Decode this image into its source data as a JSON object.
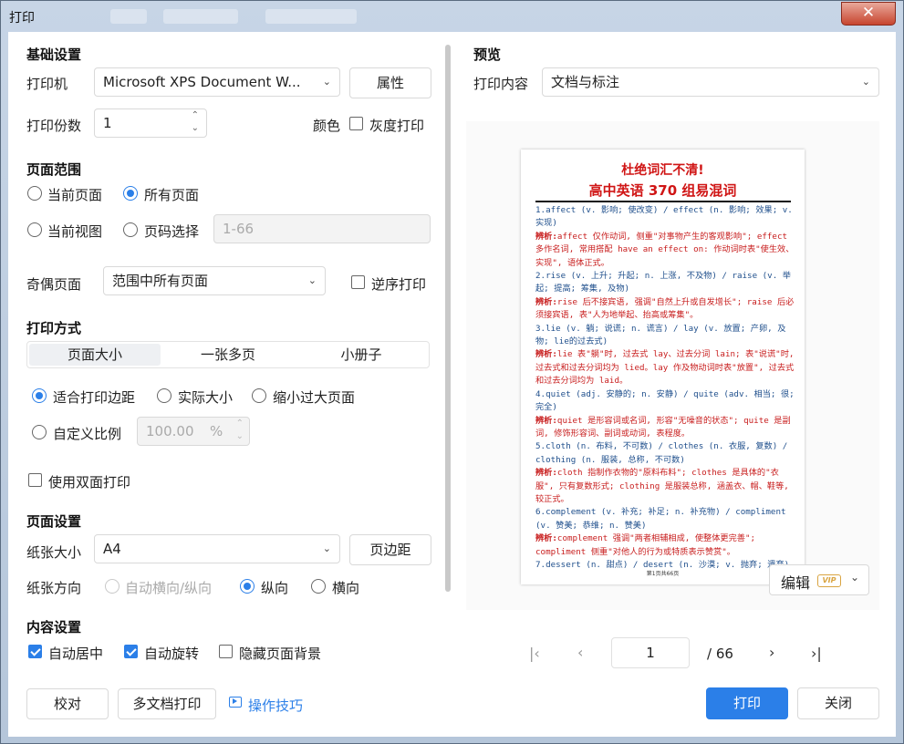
{
  "window": {
    "title": "打印",
    "close_glyph": "✕"
  },
  "basic": {
    "heading": "基础设置",
    "printer_label": "打印机",
    "printer_value": "Microsoft XPS Document W...",
    "properties_button": "属性",
    "copies_label": "打印份数",
    "copies_value": "1",
    "color_label": "颜色",
    "grayscale_label": "灰度打印",
    "grayscale_checked": false
  },
  "range": {
    "heading": "页面范围",
    "current_page": "当前页面",
    "all_pages": "所有页面",
    "current_view": "当前视图",
    "page_select": "页码选择",
    "page_select_placeholder": "1-66",
    "selected": "all_pages",
    "odd_even_label": "奇偶页面",
    "odd_even_value": "范围中所有页面",
    "reverse_label": "逆序打印",
    "reverse_checked": false
  },
  "method": {
    "heading": "打印方式",
    "tabs": [
      "页面大小",
      "一张多页",
      "小册子"
    ],
    "active_tab": 0,
    "fit_margins": "适合打印边距",
    "actual_size": "实际大小",
    "shrink_large": "缩小过大页面",
    "custom_scale": "自定义比例",
    "scale_value": "100.00",
    "scale_unit": "%",
    "selected": "fit_margins",
    "duplex_label": "使用双面打印",
    "duplex_checked": false
  },
  "page_setup": {
    "heading": "页面设置",
    "paper_size_label": "纸张大小",
    "paper_size_value": "A4",
    "margins_button": "页边距",
    "orientation_label": "纸张方向",
    "auto_orientation": "自动横向/纵向",
    "portrait": "纵向",
    "landscape": "横向",
    "selected": "portrait"
  },
  "content_setup": {
    "heading": "内容设置",
    "auto_center": "自动居中",
    "auto_center_checked": true,
    "auto_rotate": "自动旋转",
    "auto_rotate_checked": true,
    "hide_bg": "隐藏页面背景",
    "hide_bg_checked": false
  },
  "footer": {
    "proofread": "校对",
    "multi_doc_print": "多文档打印",
    "tips": "操作技巧",
    "print": "打印",
    "close": "关闭"
  },
  "preview": {
    "heading": "预览",
    "content_label": "打印内容",
    "content_value": "文档与标注",
    "edit_button": "编辑",
    "vip_badge": "VIP",
    "current_page": "1",
    "total_pages": "/ 66",
    "document": {
      "title_line1": "杜绝词汇不清!",
      "title_line2": "高中英语 370 组易混词",
      "footer": "第1页共66页",
      "entries": [
        {
          "head": "1.affect (v. 影响; 使改变) / effect (n. 影响; 效果; v. 实现)",
          "note_label": "辨析:",
          "note": "affect 仅作动词, 侧重\"对事物产生的客观影响\"; effect 多作名词, 常用搭配 have an effect on: 作动词时表\"使生效、实现\", 语体正式。"
        },
        {
          "head": "2.rise (v. 上升; 升起; n. 上涨, 不及物) / raise (v. 举起; 提高; 筹集, 及物)",
          "note_label": "辨析:",
          "note": "rise 后不接宾语, 强调\"自然上升或自发增长\"; raise 后必须接宾语, 表\"人为地举起、抬高或筹集\"。"
        },
        {
          "head": "3.lie (v. 躺; 说谎; n. 谎言) / lay (v. 放置; 产卵, 及物; lie的过去式)",
          "note_label": "辨析:",
          "note": "lie 表\"躺\"时, 过去式 lay、过去分词 lain; 表\"说谎\"时, 过去式和过去分词均为 lied。lay 作及物动词时表\"放置\", 过去式和过去分词均为 laid。"
        },
        {
          "head": "4.quiet (adj. 安静的; n. 安静) / quite (adv. 相当; 很; 完全)",
          "note_label": "辨析:",
          "note": "quiet 是形容词或名词, 形容\"无噪音的状态\"; quite 是副词, 修饰形容词、副词或动词, 表程度。"
        },
        {
          "head": "5.cloth (n. 布料, 不可数) / clothes (n. 衣服, 复数) / clothing (n. 服装, 总称, 不可数)",
          "note_label": "辨析:",
          "note": "cloth 指制作衣物的\"原料布料\"; clothes 是具体的\"衣服\", 只有复数形式; clothing 是服装总称, 涵盖衣、帽、鞋等, 较正式。"
        },
        {
          "head": "6.complement (v. 补充; 补足; n. 补充物) / compliment (v. 赞美; 恭维; n. 赞美)",
          "note_label": "辨析:",
          "note": "complement 强调\"两者相辅相成, 使整体更完善\"; compliment 侧重\"对他人的行为或特质表示赞赏\"。"
        },
        {
          "head": "7.dessert (n. 甜点) / desert (n. 沙漠; v. 抛弃; 遗弃)",
          "note_label": "",
          "note": ""
        }
      ]
    }
  }
}
